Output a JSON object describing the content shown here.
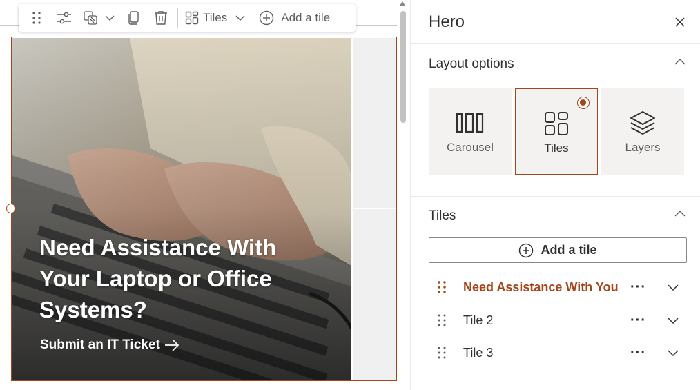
{
  "toolbar": {
    "layout_label": "Tiles",
    "add_tile_label": "Add a tile"
  },
  "hero": {
    "title": "Need Assistance With Your Laptop or Office Systems?",
    "link_text": "Submit an IT Ticket"
  },
  "panel": {
    "title": "Hero",
    "layout_section": {
      "title": "Layout options",
      "options": [
        {
          "label": "Carousel",
          "icon": "carousel-icon",
          "selected": false
        },
        {
          "label": "Tiles",
          "icon": "tiles-icon",
          "selected": true
        },
        {
          "label": "Layers",
          "icon": "layers-icon",
          "selected": false
        }
      ]
    },
    "tiles_section": {
      "title": "Tiles",
      "add_tile_label": "Add a tile",
      "tiles": [
        {
          "label": "Need Assistance With You...",
          "active": true
        },
        {
          "label": "Tile 2",
          "active": false
        },
        {
          "label": "Tile 3",
          "active": false
        }
      ],
      "more_glyph": "···"
    }
  },
  "colors": {
    "accent": "#a4461a",
    "text": "#323130",
    "muted": "#605e5c",
    "card_bg": "#f3f2f1"
  }
}
